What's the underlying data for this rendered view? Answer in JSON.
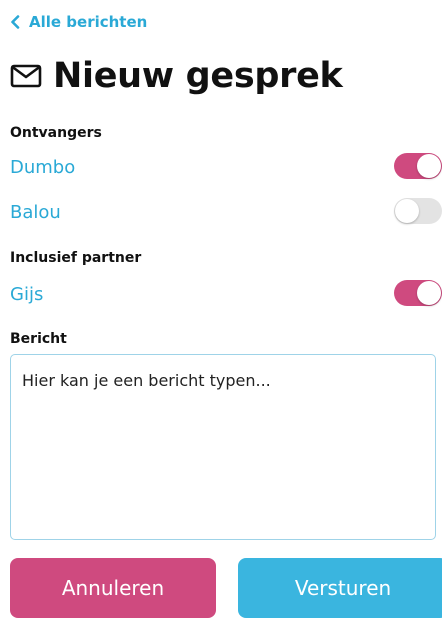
{
  "nav": {
    "back_label": "Alle berichten"
  },
  "header": {
    "title": "Nieuw gesprek"
  },
  "recipients": {
    "label": "Ontvangers",
    "items": [
      {
        "name": "Dumbo",
        "enabled": true
      },
      {
        "name": "Balou",
        "enabled": false
      }
    ]
  },
  "partner": {
    "label": "Inclusief partner",
    "items": [
      {
        "name": "Gijs",
        "enabled": true
      }
    ]
  },
  "message": {
    "label": "Bericht",
    "placeholder": "Hier kan je een bericht typen...",
    "value": ""
  },
  "actions": {
    "cancel_label": "Annuleren",
    "send_label": "Versturen"
  },
  "colors": {
    "accent_blue": "#2aa9d6",
    "accent_pink": "#cf4a7f",
    "toggle_off": "#e3e3e3"
  }
}
